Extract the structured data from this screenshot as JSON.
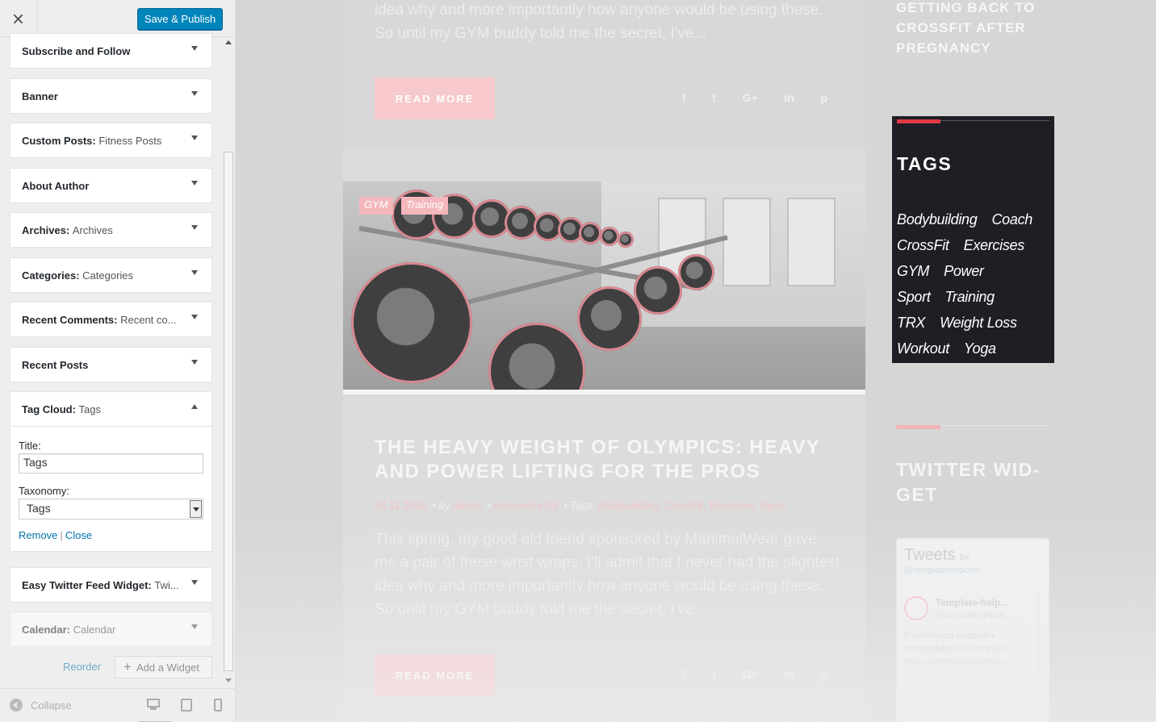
{
  "customizer": {
    "close_icon": "×",
    "save_label": "Save & Publish",
    "widgets": [
      {
        "title": "Subscribe and Follow",
        "subtitle": ""
      },
      {
        "title": "Banner",
        "subtitle": ""
      },
      {
        "title": "Custom Posts:",
        "subtitle": "Fitness Posts"
      },
      {
        "title": "About Author",
        "subtitle": ""
      },
      {
        "title": "Archives:",
        "subtitle": "Archives"
      },
      {
        "title": "Categories:",
        "subtitle": "Categories"
      },
      {
        "title": "Recent Comments:",
        "subtitle": "Recent co..."
      },
      {
        "title": "Recent Posts",
        "subtitle": ""
      },
      {
        "title": "Tag Cloud:",
        "subtitle": "Tags"
      },
      {
        "title": "Easy Twitter Feed Widget:",
        "subtitle": "Twi..."
      },
      {
        "title": "Calendar:",
        "subtitle": "Calendar"
      }
    ],
    "tag_cloud_form": {
      "title_label": "Title:",
      "title_value": "Tags",
      "taxonomy_label": "Taxonomy:",
      "taxonomy_value": "Tags",
      "remove_label": "Remove",
      "separator": "|",
      "close_label": "Close"
    },
    "reorder_label": "Reorder",
    "add_widget_label": "Add a Widget",
    "add_widget_icon": "+",
    "collapse_label": "Collapse",
    "devices": [
      "desktop-icon",
      "tablet-icon",
      "mobile-icon"
    ],
    "accent_color": "#0085ba"
  },
  "preview": {
    "top_post_text_1": "idea why and more importantly how anyone would be using these.",
    "top_post_text_2": "So until my GYM buddy told me the secret, I've...",
    "read_more": "READ MORE",
    "socials": [
      "f",
      "t",
      "G+",
      "in",
      "p"
    ],
    "image_tags": [
      "GYM",
      "Training"
    ],
    "post_title": "THE HEAVY WEIGHT OF OLYMPICS: HEAVY AND POWER LIFTING FOR THE PROS",
    "post_date": "04.11.2016",
    "post_by": "by",
    "post_author": "admin",
    "post_comments": "comments (0)",
    "post_tags_label": "Tags:",
    "post_tags": "Bodybuilding, CrossFit, Exercises, Sport",
    "excerpt": [
      "This spring, my good old friend sponsored by ManimalWear gave",
      "me a pair of these wrist wraps. I'll admit that I never had the slightest",
      "idea why and more importantly how anyone would be using these.",
      "So until my GYM buddy told me the secret, I've..."
    ],
    "read_more_2": "READ MORE",
    "sidebar": {
      "recent_title": "GETTING BACK TO CROSSFIT AFTER PREGNANCY",
      "tags_title": "TAGS",
      "tags": [
        "Bodybuilding",
        "Coach",
        "CrossFit",
        "Exercises",
        "GYM",
        "Power",
        "Sport",
        "Training",
        "TRX",
        "Weight Loss",
        "Workout",
        "Yoga"
      ],
      "twitter_title": "TWITTER WID-\nGET",
      "tweets_label": "Tweets",
      "tweets_by": "by",
      "tweets_handle": "@templatehelpcom",
      "tweet_name": "Template-help...",
      "tweet_user": "@templatehelpco...",
      "tweet_text_1": "E-commerce templates compatibility ",
      "tweet_link": "info.template-help.com/help/e-commerc...",
      "accent_red": "#e23a46",
      "accent_pink": "#f3b4ba"
    }
  }
}
